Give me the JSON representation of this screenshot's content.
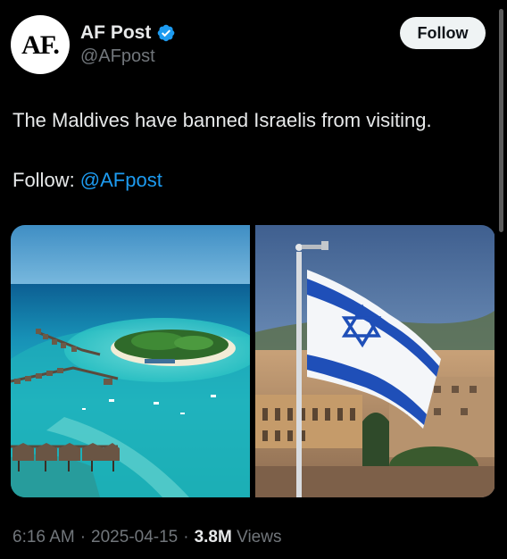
{
  "author": {
    "avatar_text": "AF.",
    "display_name": "AF Post",
    "handle": "@AFpost",
    "verified_icon": "verified-badge-icon",
    "verified_color": "#1d9bf0"
  },
  "follow_button": {
    "label": "Follow"
  },
  "tweet": {
    "text": "The Maldives have banned Israelis from visiting.",
    "follow_prefix": "Follow: ",
    "follow_mention": "@AFpost"
  },
  "media": {
    "images": [
      {
        "name": "maldives-island-photo"
      },
      {
        "name": "israel-flag-photo"
      }
    ]
  },
  "meta": {
    "time": "6:16 AM",
    "separator1": "·",
    "date": "2025-04-15",
    "separator2": "·",
    "views_count": "3.8M",
    "views_label": "Views"
  },
  "colors": {
    "background": "#000000",
    "text": "#e7e9ea",
    "secondary_text": "#71767b",
    "link": "#1d9bf0",
    "button_bg": "#eff3f4"
  }
}
